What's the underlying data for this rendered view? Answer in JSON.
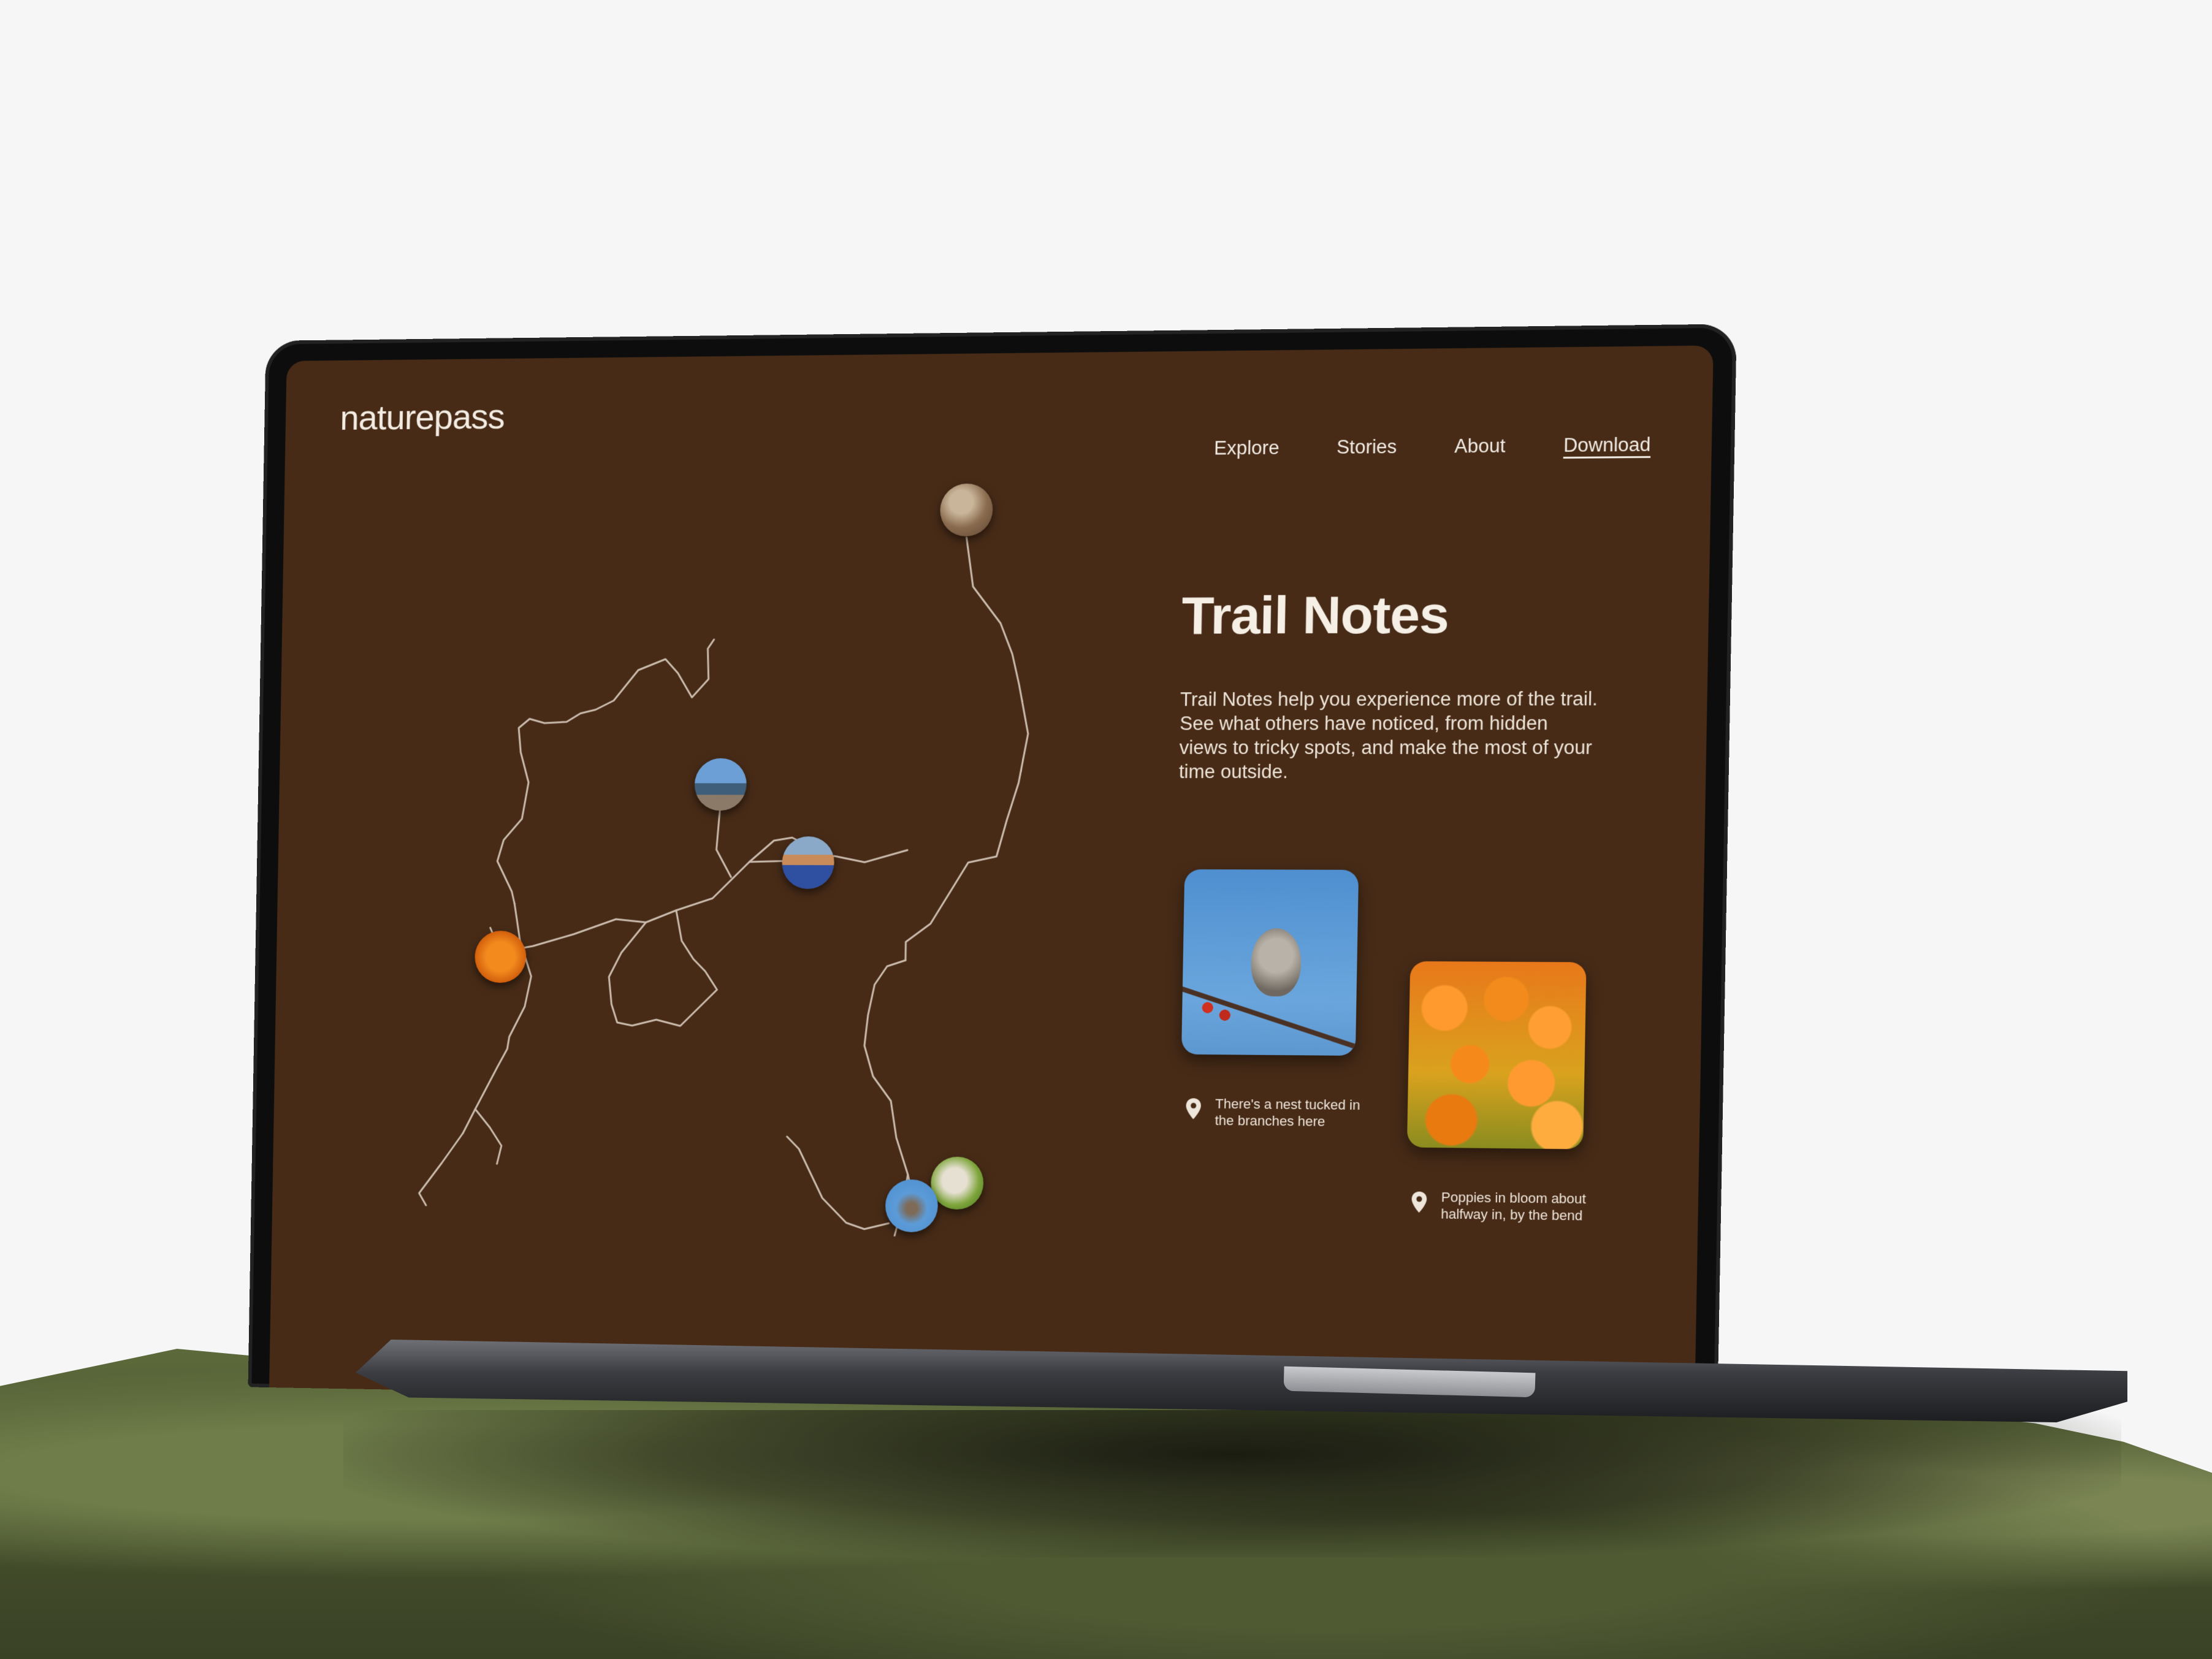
{
  "site": {
    "logo": "naturepass"
  },
  "nav": {
    "items": [
      {
        "label": "Explore"
      },
      {
        "label": "Stories"
      },
      {
        "label": "About"
      },
      {
        "label": "Download",
        "underlined": true
      }
    ]
  },
  "hero": {
    "title": "Trail Notes",
    "description": "Trail Notes help you experience more of the trail. See what others have noticed, from hidden views to tricky spots, and make the most of your time outside."
  },
  "notes": [
    {
      "photo": "bird-on-branch-photo",
      "caption": "There's a nest tucked in the branches here"
    },
    {
      "photo": "poppies-photo",
      "caption": "Poppies in bloom about halfway in, by the bend"
    }
  ],
  "map": {
    "pins": [
      {
        "name": "map-pin-mountain-photo"
      },
      {
        "name": "map-pin-hikers-photo"
      },
      {
        "name": "map-pin-sunset-photo"
      },
      {
        "name": "map-pin-poppies-photo"
      },
      {
        "name": "map-pin-cairn-photo"
      },
      {
        "name": "map-pin-bird-photo"
      }
    ]
  },
  "colors": {
    "screen_background": "#472b17",
    "text": "#f5efe6",
    "trail_line": "#cbbcae",
    "page_background": "#f6f6f6"
  }
}
